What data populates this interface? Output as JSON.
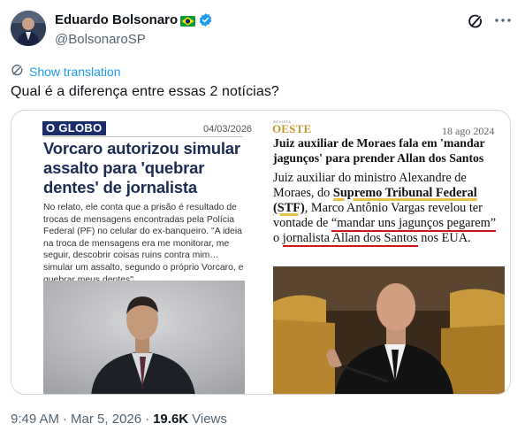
{
  "author": {
    "display_name": "Eduardo Bolsonaro",
    "handle": "@BolsonaroSP",
    "flag_icon": "brazil-flag-icon",
    "verified_icon": "verified-badge-icon"
  },
  "translate_label": "Show translation",
  "tweet_text": "Qual é a diferença entre essas 2 notícias?",
  "left_article": {
    "logo": "O GLOBO",
    "date": "04/03/2026",
    "headline": "Vorcaro autorizou simular assalto para 'quebrar dentes' de jornalista",
    "body": "No relato, ele conta que a prisão é resultado de trocas de mensagens encontradas pela Polícia Federal (PF) no celular do ex-banqueiro. \"A ideia na troca de mensagens era me monitorar, me seguir, descobrir coisas ruins contra mim… simular um assalto, segundo o próprio Vorcaro, e quebrar meus dentes\"."
  },
  "right_article": {
    "logo_sub": "REVISTA",
    "logo": "OESTE",
    "date": "18 ago 2024",
    "headline": "Juiz auxiliar de Moraes fala em 'mandar jagunços' para prender Allan dos Santos",
    "body_1": "Juiz auxiliar do ministro Alexandre de Moraes, do ",
    "body_link": "Supremo Tribunal Federal (STF)",
    "body_2": ", Marco Antônio Vargas revelou ter vontade de ",
    "body_quote": "“mandar uns jagunços pegarem”",
    "body_3": " o ",
    "body_name": "jornalista Allan dos Santos",
    "body_4": " nos EUA."
  },
  "footer": {
    "time": "9:49 AM",
    "separator": "·",
    "date": "Mar 5, 2026",
    "views_count": "19.6K",
    "views_label": "Views"
  },
  "colors": {
    "link_blue": "#1d9bf0",
    "globo_navy": "#1b2d6b",
    "oeste_gold": "#c09a2f",
    "underline_red": "#d41515"
  }
}
